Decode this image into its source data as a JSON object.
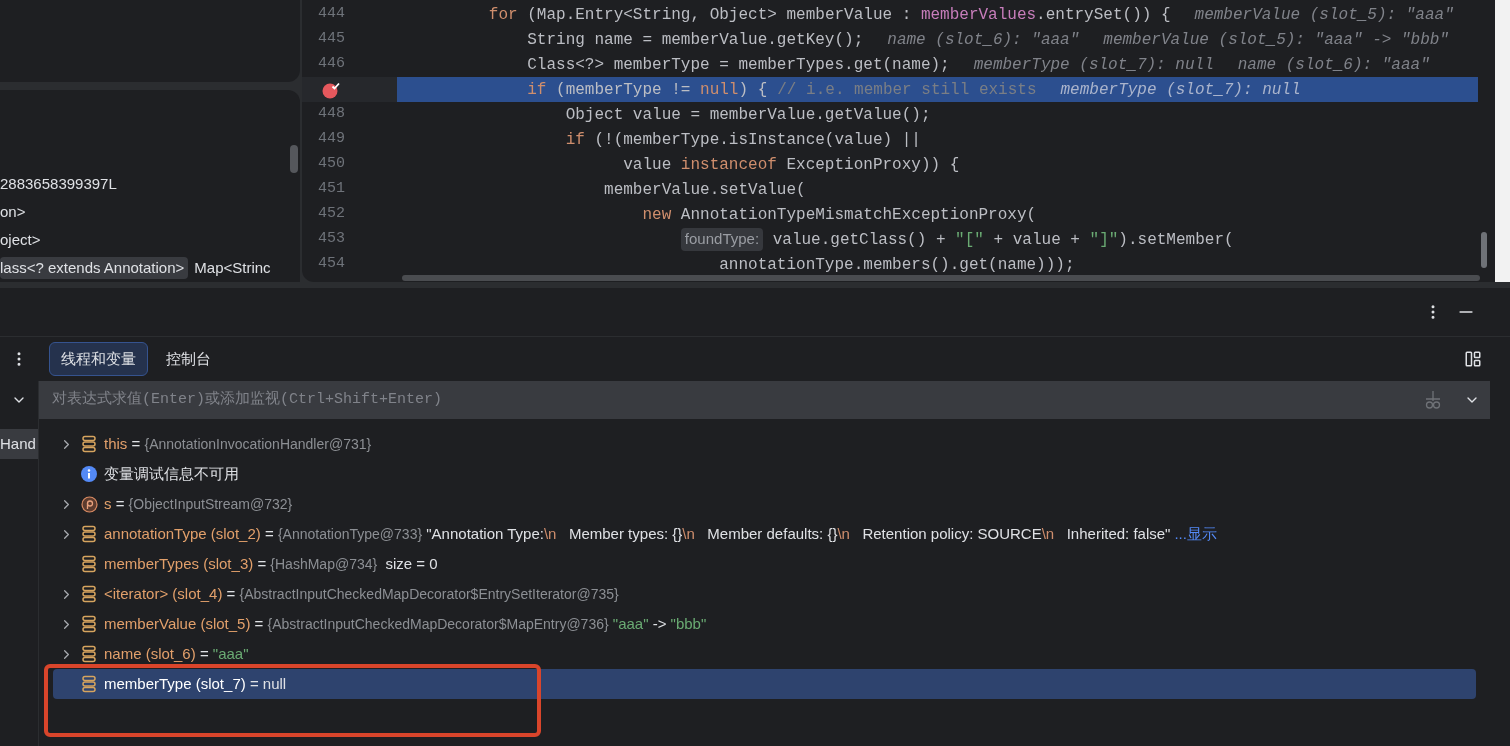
{
  "left_panel": {
    "lines": [
      {
        "text": "2883658399397L"
      },
      {
        "text": "on>"
      },
      {
        "text": "oject>"
      },
      {
        "chip": "lass<? extends Annotation>",
        "text": "Map<Strinc"
      }
    ]
  },
  "editor": {
    "lines": [
      {
        "number": "444",
        "breakpoint": false,
        "current": false,
        "segments": [
          {
            "kind": "kw",
            "text": "        for"
          },
          {
            "kind": "plain",
            "text": " (Map.Entry<String, Object> memberValue : "
          },
          {
            "kind": "field",
            "text": "memberValues"
          },
          {
            "kind": "plain",
            "text": ".entrySet()) {"
          },
          {
            "kind": "hint",
            "text": "memberValue (slot_5): \"aaa\""
          }
        ]
      },
      {
        "number": "445",
        "breakpoint": false,
        "current": false,
        "segments": [
          {
            "kind": "plain",
            "text": "            String name = memberValue.getKey();"
          },
          {
            "kind": "hint",
            "text": "name (slot_6): \"aaa\""
          },
          {
            "kind": "hint",
            "text": "memberValue (slot_5): \"aaa\" -> \"bbb\""
          }
        ]
      },
      {
        "number": "446",
        "breakpoint": false,
        "current": false,
        "segments": [
          {
            "kind": "plain",
            "text": "            Class<?> memberType = memberTypes.get(name);"
          },
          {
            "kind": "hint",
            "text": "memberType (slot_7): null"
          },
          {
            "kind": "hint",
            "text": "name (slot_6): \"aaa\""
          }
        ]
      },
      {
        "breakpoint": true,
        "current": true,
        "segments": [
          {
            "kind": "kw",
            "text": "            if"
          },
          {
            "kind": "plain",
            "text": " (memberType != "
          },
          {
            "kind": "kw",
            "text": "null"
          },
          {
            "kind": "plain",
            "text": ") {"
          },
          {
            "kind": "comment",
            "text": "// i.e. member still exists"
          },
          {
            "kind": "hint",
            "text": "memberType (slot_7): null"
          }
        ]
      },
      {
        "number": "448",
        "breakpoint": false,
        "current": false,
        "segments": [
          {
            "kind": "plain",
            "text": "                Object value = memberValue.getValue();"
          }
        ]
      },
      {
        "number": "449",
        "breakpoint": false,
        "current": false,
        "segments": [
          {
            "kind": "kw",
            "text": "                if"
          },
          {
            "kind": "plain",
            "text": " (!(memberType.isInstance(value) ||"
          }
        ]
      },
      {
        "number": "450",
        "breakpoint": false,
        "current": false,
        "segments": [
          {
            "kind": "plain",
            "text": "                      value "
          },
          {
            "kind": "kw",
            "text": "instanceof"
          },
          {
            "kind": "plain",
            "text": " ExceptionProxy)) {"
          }
        ]
      },
      {
        "number": "451",
        "breakpoint": false,
        "current": false,
        "segments": [
          {
            "kind": "plain",
            "text": "                    memberValue.setValue("
          }
        ]
      },
      {
        "number": "452",
        "breakpoint": false,
        "current": false,
        "segments": [
          {
            "kind": "kw",
            "text": "                        new"
          },
          {
            "kind": "plain",
            "text": " AnnotationTypeMismatchExceptionProxy("
          }
        ]
      },
      {
        "number": "453",
        "breakpoint": false,
        "current": false,
        "segments": [
          {
            "kind": "chip",
            "text": "                            foundType:"
          },
          {
            "kind": "plain",
            "text": " value.getClass() + "
          },
          {
            "kind": "str",
            "text": "\"[\""
          },
          {
            "kind": "plain",
            "text": " + value + "
          },
          {
            "kind": "str",
            "text": "\"]\""
          },
          {
            "kind": "plain",
            "text": ").setMember("
          }
        ]
      },
      {
        "number": "454",
        "breakpoint": false,
        "current": false,
        "segments": [
          {
            "kind": "plain",
            "text": "                                annotationType.members().get(name)));"
          }
        ]
      }
    ]
  },
  "debugger": {
    "tabs": [
      {
        "label": "线程和变量",
        "selected": true
      },
      {
        "label": "控制台",
        "selected": false
      }
    ],
    "expression_field": {
      "placeholder": "对表达式求值(Enter)或添加监视(Ctrl+Shift+Enter)"
    },
    "frame_item": "Hand",
    "variables": [
      {
        "kind": "field",
        "expandable": true,
        "selected": false,
        "segments": [
          {
            "kind": "name",
            "text": "this"
          },
          {
            "kind": "op",
            "text": " = "
          },
          {
            "kind": "ref",
            "text": "{AnnotationInvocationHandler@731}"
          }
        ]
      },
      {
        "kind": "info",
        "expandable": false,
        "selected": false,
        "segments": [
          {
            "kind": "plain",
            "text": "变量调试信息不可用"
          }
        ]
      },
      {
        "kind": "param",
        "expandable": true,
        "selected": false,
        "segments": [
          {
            "kind": "name",
            "text": "s"
          },
          {
            "kind": "op",
            "text": " = "
          },
          {
            "kind": "ref",
            "text": "{ObjectInputStream@732}"
          }
        ]
      },
      {
        "kind": "field",
        "expandable": true,
        "selected": false,
        "segments": [
          {
            "kind": "name",
            "text": "annotationType (slot_2)"
          },
          {
            "kind": "op",
            "text": " = "
          },
          {
            "kind": "ref",
            "text": "{AnnotationType@733}"
          },
          {
            "kind": "plain",
            "text": " \"Annotation Type:"
          },
          {
            "kind": "esc",
            "text": "\\n"
          },
          {
            "kind": "plain",
            "text": "   Member types: {}"
          },
          {
            "kind": "esc",
            "text": "\\n"
          },
          {
            "kind": "plain",
            "text": "   Member defaults: {}"
          },
          {
            "kind": "esc",
            "text": "\\n"
          },
          {
            "kind": "plain",
            "text": "   Retention policy: SOURCE"
          },
          {
            "kind": "esc",
            "text": "\\n"
          },
          {
            "kind": "plain",
            "text": "   Inherited: false\""
          }
        ],
        "link": "...显示"
      },
      {
        "kind": "field",
        "expandable": false,
        "selected": false,
        "segments": [
          {
            "kind": "name",
            "text": "memberTypes (slot_3)"
          },
          {
            "kind": "op",
            "text": " = "
          },
          {
            "kind": "ref",
            "text": "{HashMap@734}"
          },
          {
            "kind": "plain",
            "text": "  size = 0"
          }
        ]
      },
      {
        "kind": "field",
        "expandable": true,
        "selected": false,
        "segments": [
          {
            "kind": "name",
            "text": "<iterator> (slot_4)"
          },
          {
            "kind": "op",
            "text": " = "
          },
          {
            "kind": "ref",
            "text": "{AbstractInputCheckedMapDecorator$EntrySetIterator@735}"
          }
        ]
      },
      {
        "kind": "field",
        "expandable": true,
        "selected": false,
        "segments": [
          {
            "kind": "name",
            "text": "memberValue (slot_5)"
          },
          {
            "kind": "op",
            "text": " = "
          },
          {
            "kind": "ref",
            "text": "{AbstractInputCheckedMapDecorator$MapEntry@736}"
          },
          {
            "kind": "str",
            "text": " \"aaa\""
          },
          {
            "kind": "plain",
            "text": " -> "
          },
          {
            "kind": "str",
            "text": "\"bbb\""
          }
        ]
      },
      {
        "kind": "field",
        "expandable": true,
        "selected": false,
        "segments": [
          {
            "kind": "name",
            "text": "name (slot_6)"
          },
          {
            "kind": "op",
            "text": " = "
          },
          {
            "kind": "str",
            "text": "\"aaa\""
          }
        ]
      },
      {
        "kind": "field",
        "expandable": false,
        "selected": true,
        "segments": [
          {
            "kind": "name",
            "text": "memberType (slot_7)"
          },
          {
            "kind": "op",
            "text": " = "
          },
          {
            "kind": "plain",
            "text": "null"
          }
        ]
      }
    ]
  }
}
